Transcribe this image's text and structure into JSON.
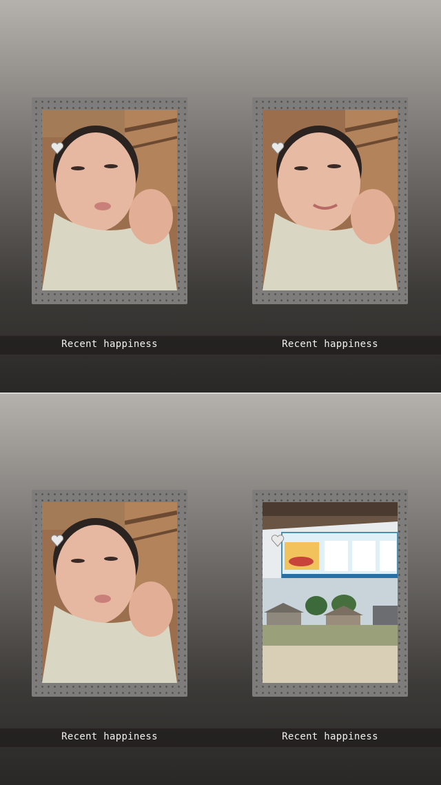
{
  "panels": [
    {
      "left": {
        "caption": "Recent happiness",
        "photo": "selfie",
        "icon": "heart-sticker-icon"
      },
      "right": {
        "caption": "Recent happiness",
        "photo": "selfie-smile",
        "icon": "heart-sticker-icon"
      }
    },
    {
      "left": {
        "caption": "Recent happiness",
        "photo": "selfie",
        "icon": "heart-sticker-icon"
      },
      "right": {
        "caption": "Recent happiness",
        "photo": "village-landscape",
        "icon": "heart-sticker-icon"
      }
    }
  ],
  "colors": {
    "frame": "#7f7d7b",
    "caption_text": "#f3f1ee",
    "panel_top": "#b5b2ad",
    "panel_bottom": "#2a2826"
  }
}
